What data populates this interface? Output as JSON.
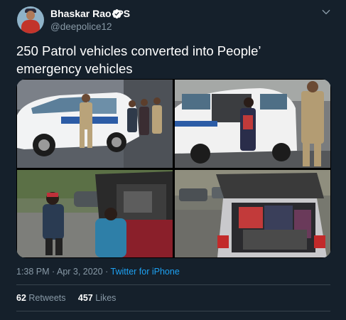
{
  "author": {
    "name": "Bhaskar Rao IPS",
    "handle": "@deepolice12",
    "verified": true,
    "avatar_icon": "profile-avatar"
  },
  "menu_icon": "chevron-down-icon",
  "tweet": {
    "text": "250 Patrol vehicles converted into People’ emergency vehicles"
  },
  "media": {
    "layout": "2x2 grid",
    "photos": [
      "police officer beside patrol car with open door",
      "woman boarding patrol car with officer nearby",
      "people loading items into car trunk on street",
      "items inside open hatchback trunk"
    ]
  },
  "meta": {
    "time": "1:38 PM",
    "separator1": " · ",
    "date": "Apr 3, 2020",
    "separator2": " · ",
    "source": "Twitter for iPhone"
  },
  "stats": {
    "retweets_count": "62",
    "retweets_label": "Retweets",
    "likes_count": "457",
    "likes_label": "Likes"
  },
  "colors": {
    "background": "#15202b",
    "secondary_text": "#8899a6",
    "link": "#1da1f2",
    "divider": "#38444d"
  }
}
